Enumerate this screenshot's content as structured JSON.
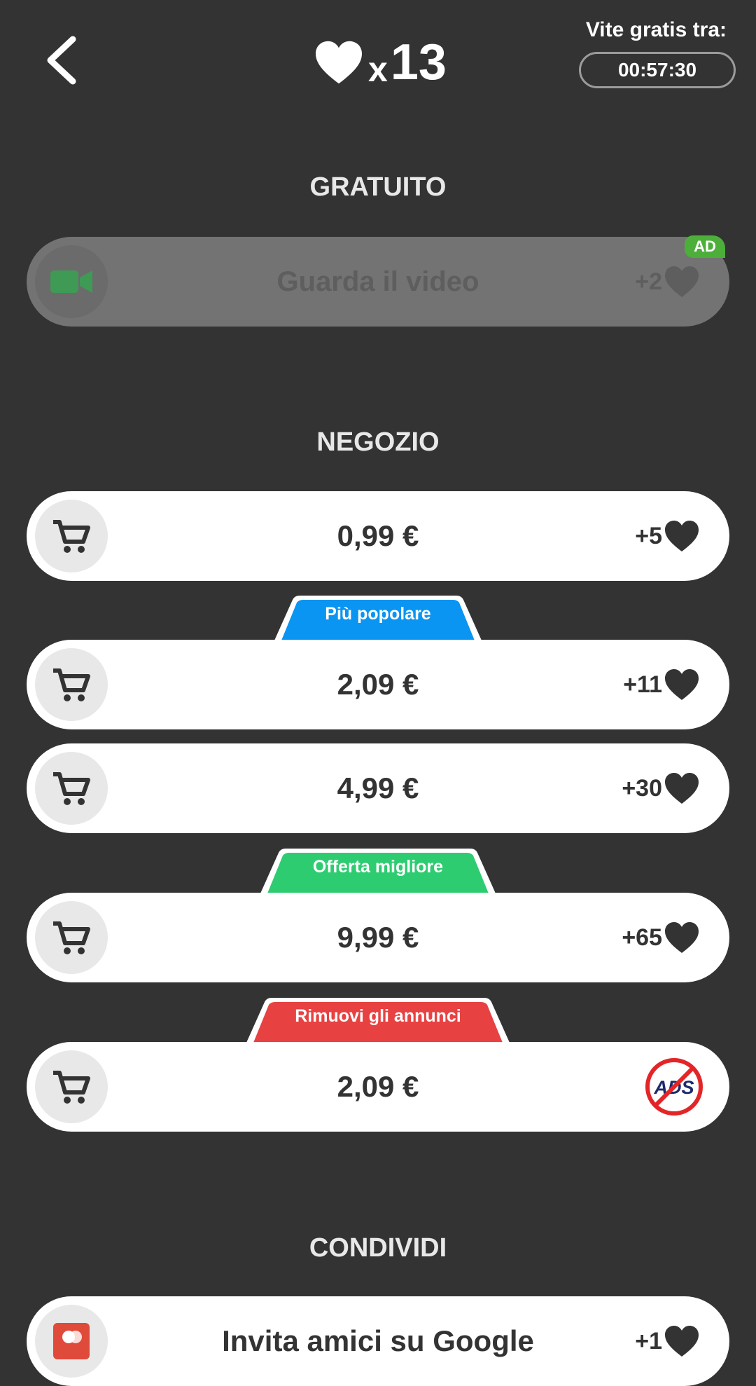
{
  "header": {
    "lives_prefix": "x",
    "lives_count": "13",
    "timer_label": "Vite gratis tra:",
    "timer_value": "00:57:30"
  },
  "sections": {
    "free": "GRATUITO",
    "shop": "NEGOZIO",
    "share": "CONDIVIDI"
  },
  "free_offer": {
    "label": "Guarda il video",
    "reward": "+2",
    "badge": "AD",
    "icon": "video-camera-icon"
  },
  "shop_items": [
    {
      "price": "0,99 €",
      "reward": "+5"
    },
    {
      "tag": "Più popolare",
      "tag_color": "#0a95f2",
      "price": "2,09 €",
      "reward": "+11"
    },
    {
      "price": "4,99 €",
      "reward": "+30"
    },
    {
      "tag": "Offerta migliore",
      "tag_color": "#2ecc71",
      "price": "9,99 €",
      "reward": "+65"
    },
    {
      "tag": "Rimuovi gli annunci",
      "tag_color": "#e84142",
      "price": "2,09 €",
      "reward_icon": "no-ads-icon",
      "reward_icon_text": "ADS"
    }
  ],
  "share_offer": {
    "label": "Invita amici su Google",
    "reward": "+1",
    "icon": "google-invite-icon"
  },
  "colors": {
    "background": "#333333",
    "row": "#ffffff",
    "disabled_row": "#737373",
    "ad_badge": "#4caf3a"
  }
}
